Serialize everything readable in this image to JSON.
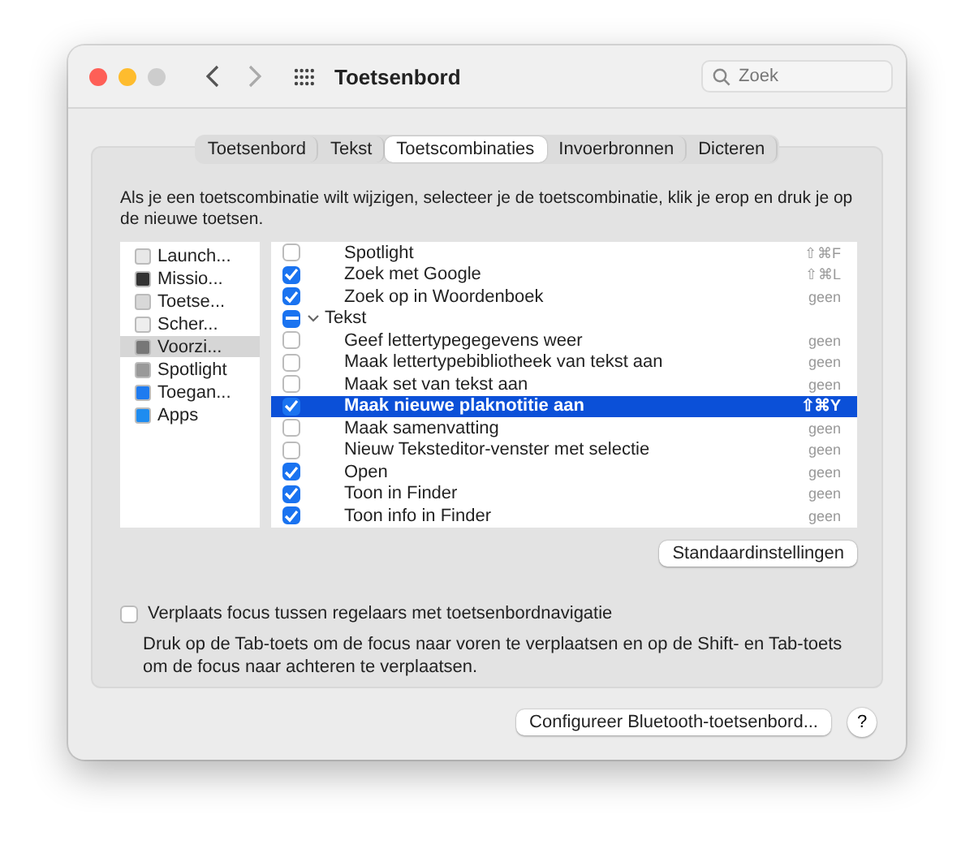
{
  "window": {
    "title": "Toetsenbord"
  },
  "search": {
    "placeholder": "Zoek"
  },
  "tabs": [
    {
      "label": "Toetsenbord",
      "selected": false
    },
    {
      "label": "Tekst",
      "selected": false
    },
    {
      "label": "Toetscombinaties",
      "selected": true
    },
    {
      "label": "Invoerbronnen",
      "selected": false
    },
    {
      "label": "Dicteren",
      "selected": false
    }
  ],
  "intro": "Als je een toetscombinatie wilt wijzigen, selecteer je de toetscombinatie, klik je erop en druk je op de nieuwe toetsen.",
  "categories": [
    {
      "label": "Launch...",
      "selected": false
    },
    {
      "label": "Missio...",
      "selected": false
    },
    {
      "label": "Toetse...",
      "selected": false
    },
    {
      "label": "Scher...",
      "selected": false
    },
    {
      "label": "Voorzi...",
      "selected": true
    },
    {
      "label": "Spotlight",
      "selected": false
    },
    {
      "label": "Toegan...",
      "selected": false
    },
    {
      "label": "Apps",
      "selected": false
    }
  ],
  "shortcuts": [
    {
      "kind": "item",
      "label": "Spotlight",
      "checked": false,
      "selected": false,
      "shortcut": "⇧⌘F"
    },
    {
      "kind": "item",
      "label": "Zoek met Google",
      "checked": true,
      "selected": false,
      "shortcut": "⇧⌘L"
    },
    {
      "kind": "item",
      "label": "Zoek op in Woordenboek",
      "checked": true,
      "selected": false,
      "shortcut": "geen"
    },
    {
      "kind": "group",
      "label": "Tekst",
      "mixed": true,
      "expanded": true
    },
    {
      "kind": "item",
      "label": "Geef lettertypegegevens weer",
      "checked": false,
      "selected": false,
      "shortcut": "geen"
    },
    {
      "kind": "item",
      "label": "Maak lettertypebibliotheek van tekst aan",
      "checked": false,
      "selected": false,
      "shortcut": "geen"
    },
    {
      "kind": "item",
      "label": "Maak set van tekst aan",
      "checked": false,
      "selected": false,
      "shortcut": "geen"
    },
    {
      "kind": "item",
      "label": "Maak nieuwe plaknotitie aan",
      "checked": true,
      "selected": true,
      "shortcut": "⇧⌘Y"
    },
    {
      "kind": "item",
      "label": "Maak samenvatting",
      "checked": false,
      "selected": false,
      "shortcut": "geen"
    },
    {
      "kind": "item",
      "label": "Nieuw Teksteditor-venster met selectie",
      "checked": false,
      "selected": false,
      "shortcut": "geen"
    },
    {
      "kind": "item",
      "label": "Open",
      "checked": true,
      "selected": false,
      "shortcut": "geen"
    },
    {
      "kind": "item",
      "label": "Toon in Finder",
      "checked": true,
      "selected": false,
      "shortcut": "geen"
    },
    {
      "kind": "item",
      "label": "Toon info in Finder",
      "checked": true,
      "selected": false,
      "shortcut": "geen"
    }
  ],
  "defaults_button": "Standaardinstellingen",
  "focus_option": {
    "label": "Verplaats focus tussen regelaars met toetsenbordnavigatie",
    "checked": false,
    "description": "Druk op de Tab-toets om de focus naar voren te verplaatsen en op de Shift- en Tab-toets om de focus naar achteren te verplaatsen."
  },
  "bluetooth_button": "Configureer Bluetooth-toetsenbord...",
  "help_button": "?"
}
